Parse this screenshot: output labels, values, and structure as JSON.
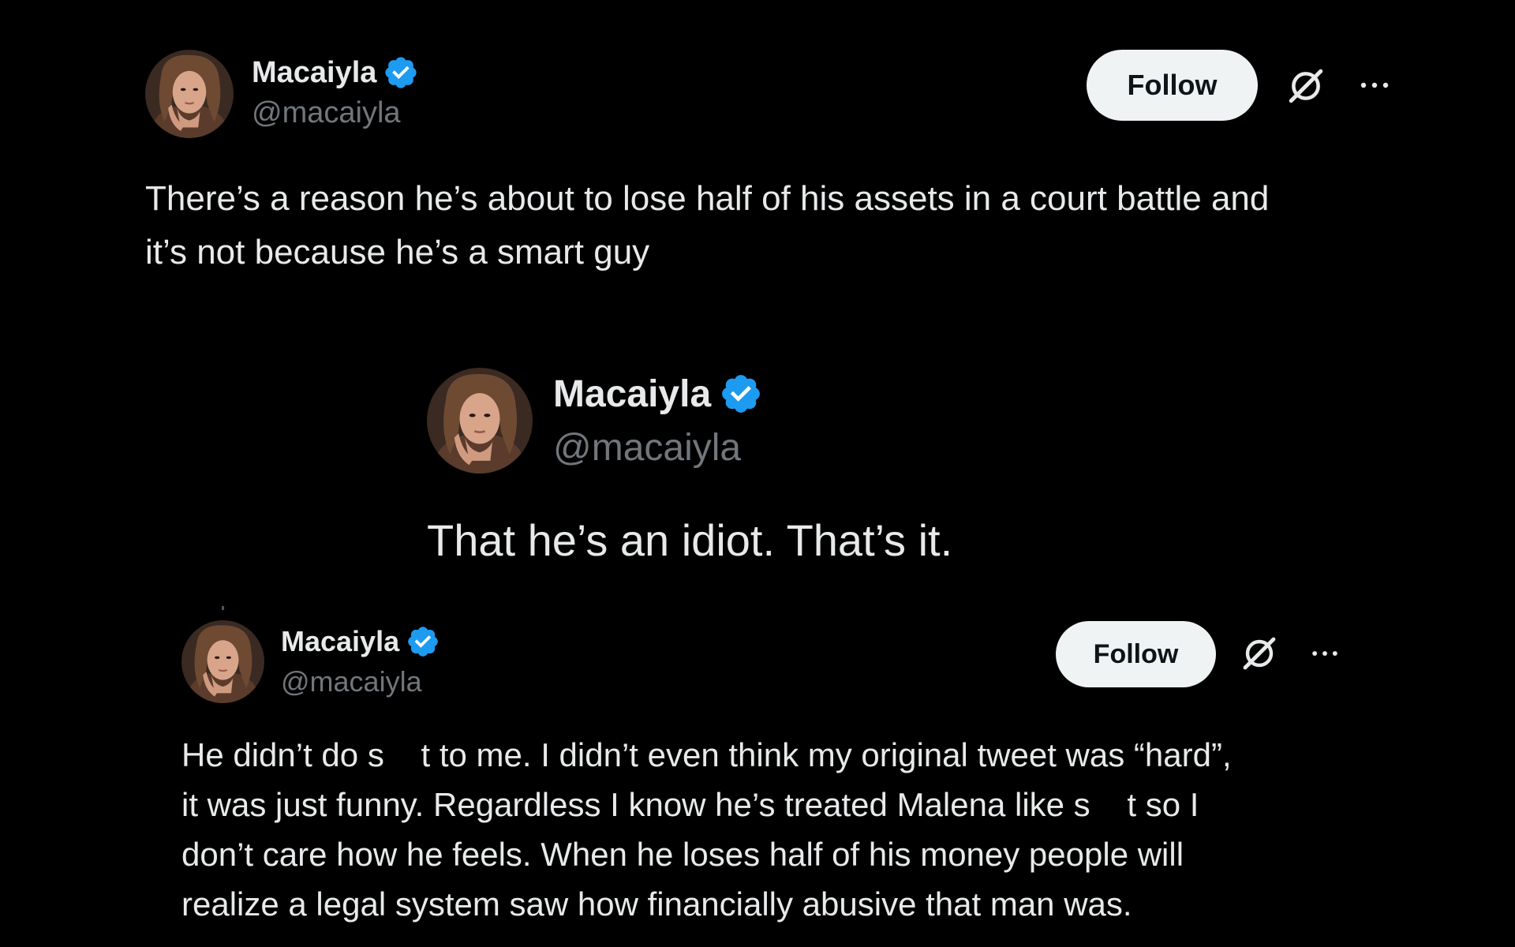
{
  "tweets": [
    {
      "display_name": "Macaiyla",
      "handle": "@macaiyla",
      "verified": true,
      "follow_label": "Follow",
      "text": "There’s a reason he’s about to lose half of his assets in a court battle and\nit’s not because he’s a smart guy"
    },
    {
      "display_name": "Macaiyla",
      "handle": "@macaiyla",
      "verified": true,
      "text": "That he’s an idiot. That’s it."
    },
    {
      "display_name": "Macaiyla",
      "handle": "@macaiyla",
      "verified": true,
      "follow_label": "Follow",
      "text": "He didn’t do s    t to me. I didn’t even think my original tweet was “hard”,\nit was just funny. Regardless I know he’s treated Malena like s    t so I\ndon’t care how he feels. When he loses half of his money people will\nrealize a legal system saw how financially abusive that man was."
    }
  ],
  "colors": {
    "background": "#000000",
    "text_primary": "#e7e9ea",
    "text_secondary": "#71767b",
    "verified_blue": "#1d9bf0",
    "follow_bg": "#eff3f4",
    "follow_text": "#0f1419"
  },
  "icons": {
    "verified": "verified-badge-icon",
    "grok": "grok-icon",
    "more": "more-options-icon",
    "avatar": "profile-avatar"
  }
}
